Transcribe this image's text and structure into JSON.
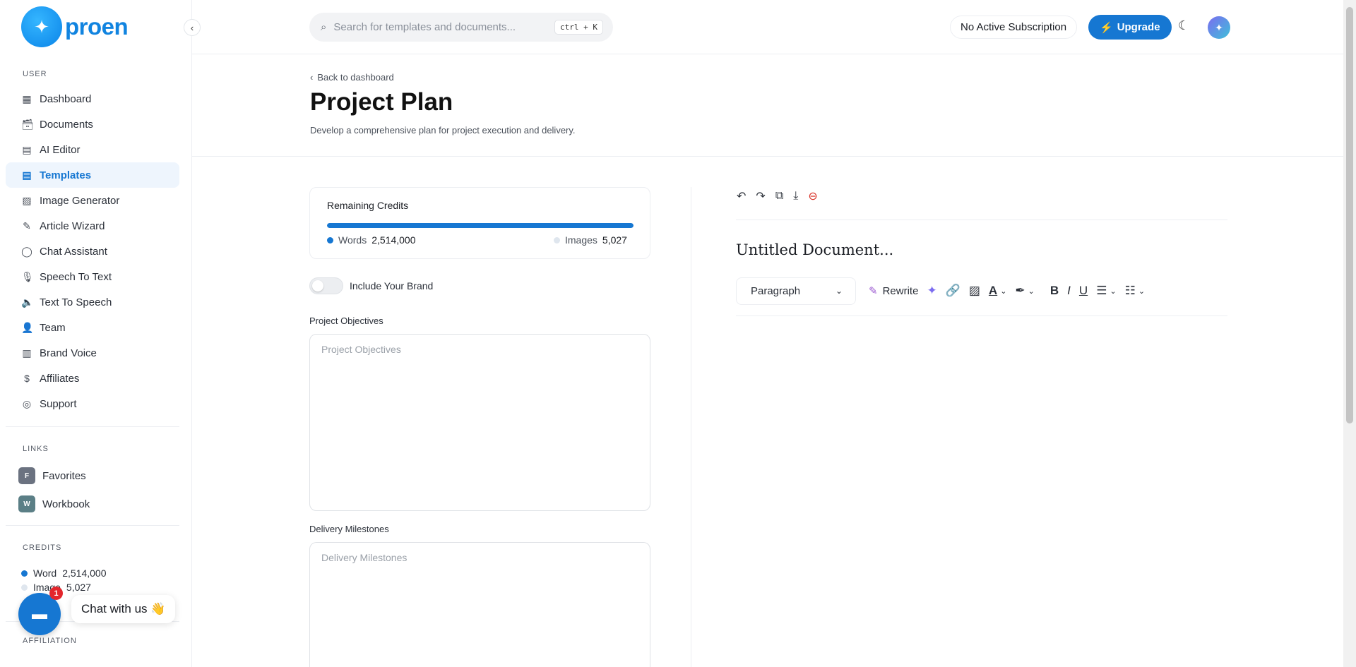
{
  "brand": {
    "name": "proen"
  },
  "sidebar": {
    "section_user": "USER",
    "items": [
      {
        "label": "Dashboard",
        "icon": "grid-icon"
      },
      {
        "label": "Documents",
        "icon": "archive-icon"
      },
      {
        "label": "AI Editor",
        "icon": "book-icon"
      },
      {
        "label": "Templates",
        "icon": "file-text-icon",
        "active": true
      },
      {
        "label": "Image Generator",
        "icon": "image-icon"
      },
      {
        "label": "Article Wizard",
        "icon": "file-edit-icon"
      },
      {
        "label": "Chat Assistant",
        "icon": "message-circle-icon"
      },
      {
        "label": "Speech To Text",
        "icon": "mic-icon"
      },
      {
        "label": "Text To Speech",
        "icon": "volume-icon"
      },
      {
        "label": "Team",
        "icon": "user-plus-icon"
      },
      {
        "label": "Brand Voice",
        "icon": "layout-icon"
      },
      {
        "label": "Affiliates",
        "icon": "dollar-icon"
      },
      {
        "label": "Support",
        "icon": "lifebuoy-icon"
      }
    ],
    "section_links": "LINKS",
    "links": [
      {
        "letter": "F",
        "label": "Favorites",
        "color": "#6b7280"
      },
      {
        "letter": "W",
        "label": "Workbook",
        "color": "#5b7f86"
      }
    ],
    "section_credits": "CREDITS",
    "credits": [
      {
        "label": "Word",
        "value": "2,514,000",
        "color": "#1677d2"
      },
      {
        "label": "Image",
        "value": "5,027",
        "color": "#dfe6ee"
      }
    ],
    "section_affiliation": "AFFILIATION"
  },
  "chat_widget": {
    "label": "Chat with us 👋",
    "badge": "1"
  },
  "header": {
    "search_placeholder": "Search for templates and documents...",
    "shortcut": "ctrl + K",
    "subscription": "No Active Subscription",
    "upgrade": "Upgrade"
  },
  "page": {
    "back": "Back to dashboard",
    "title": "Project Plan",
    "subtitle": "Develop a comprehensive plan for project execution and delivery."
  },
  "credits_card": {
    "title": "Remaining Credits",
    "progress": 1.0,
    "words_label": "Words",
    "words_value": "2,514,000",
    "images_label": "Images",
    "images_value": "5,027"
  },
  "form": {
    "brand_toggle": "Include Your Brand",
    "objectives_label": "Project Objectives",
    "objectives_placeholder": "Project Objectives",
    "milestones_label": "Delivery Milestones",
    "milestones_placeholder": "Delivery Milestones"
  },
  "editor": {
    "doc_title": "Untitled Document...",
    "block_type": "Paragraph",
    "rewrite": "Rewrite"
  },
  "colors": {
    "accent": "#1677d2",
    "danger": "#d93025"
  }
}
